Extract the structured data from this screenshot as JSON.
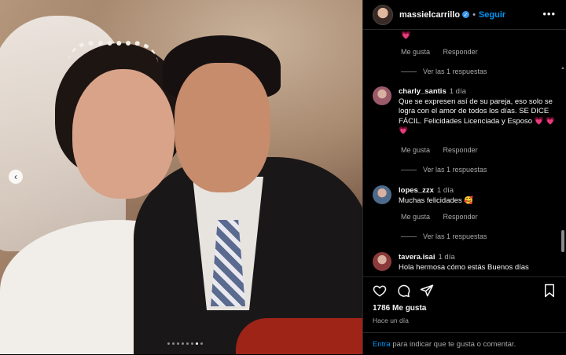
{
  "header": {
    "username": "massielcarrillo",
    "separator": "•",
    "follow_label": "Seguir",
    "more_label": "•••"
  },
  "comments": {
    "first": {
      "text": "💗",
      "likes_label": "Me gusta",
      "reply_label": "Responder",
      "view_replies": "Ver las 1 respuestas"
    },
    "items": [
      {
        "username": "charly_santis",
        "time": "1 día",
        "text": "Que se expresen así de su pareja, eso solo se logra con el amor de todos los días. SE DICE FÁCIL. Felicidades Licenciada y Esposo 💗 💗 💗",
        "likes_label": "Me gusta",
        "reply_label": "Responder",
        "view_replies": "Ver las 1 respuestas",
        "avatar_color": "#9a5a6a"
      },
      {
        "username": "lopes_zzx",
        "time": "1 día",
        "text": "Muchas felicidades 🥰",
        "likes_label": "Me gusta",
        "reply_label": "Responder",
        "view_replies": "Ver las 1 respuestas",
        "avatar_color": "#4d6a8a"
      },
      {
        "username": "tavera.isai",
        "time": "1 día",
        "text": "Hola hermosa cómo estás Buenos días",
        "avatar_color": "#8a3a3a"
      }
    ]
  },
  "actions": {
    "like_icon": "heart-outline",
    "comment_icon": "speech-bubble",
    "share_icon": "paper-plane",
    "save_icon": "bookmark"
  },
  "likes_count": "1786 Me gusta",
  "posted": "Hace un día",
  "footer": {
    "login_link": "Entra",
    "prompt": "para indicar que te gusta o comentar."
  },
  "carousel": {
    "prev_label": "‹",
    "total_slides": 8,
    "current_slide": 7
  },
  "colors": {
    "accent": "#0095f6",
    "heart": "#ff3040",
    "background": "#000000"
  }
}
